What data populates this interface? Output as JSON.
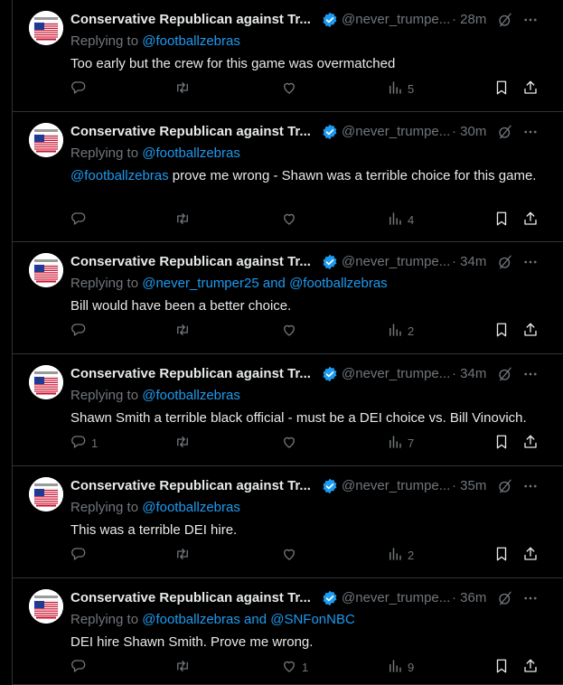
{
  "tweets": [
    {
      "name": "Conservative Republican against Tr...",
      "handle": "@never_trumpe...",
      "time": "· 28m",
      "reply_prefix": "Replying to ",
      "reply_to": "@footballzebras",
      "reply_extra_sep": "",
      "reply_extra": "",
      "mention": "",
      "text": "Too early but the crew for this game was overmatched",
      "replies": "",
      "likes": "",
      "views": "5"
    },
    {
      "name": "Conservative Republican against Tr...",
      "handle": "@never_trumpe...",
      "time": "· 30m",
      "reply_prefix": "Replying to ",
      "reply_to": "@footballzebras",
      "reply_extra_sep": "",
      "reply_extra": "",
      "mention": "@footballzebras",
      "text": " prove me wrong - Shawn was a terrible choice for this game.",
      "replies": "",
      "likes": "",
      "views": "4"
    },
    {
      "name": "Conservative Republican against Tr...",
      "handle": "@never_trumpe...",
      "time": "· 34m",
      "reply_prefix": "Replying to ",
      "reply_to": "@never_trumper25",
      "reply_extra_sep": " and ",
      "reply_extra": "@footballzebras",
      "mention": "",
      "text": "Bill would have been a better choice.",
      "replies": "",
      "likes": "",
      "views": "2"
    },
    {
      "name": "Conservative Republican against Tr...",
      "handle": "@never_trumpe...",
      "time": "· 34m",
      "reply_prefix": "Replying to ",
      "reply_to": "@footballzebras",
      "reply_extra_sep": "",
      "reply_extra": "",
      "mention": "",
      "text": "Shawn Smith a terrible black official - must be a DEI choice vs. Bill Vinovich.",
      "replies": "1",
      "likes": "",
      "views": "7"
    },
    {
      "name": "Conservative Republican against Tr...",
      "handle": "@never_trumpe...",
      "time": "· 35m",
      "reply_prefix": "Replying to ",
      "reply_to": "@footballzebras",
      "reply_extra_sep": "",
      "reply_extra": "",
      "mention": "",
      "text": "This was a terrible DEI hire.",
      "replies": "",
      "likes": "",
      "views": "2"
    },
    {
      "name": "Conservative Republican against Tr...",
      "handle": "@never_trumpe...",
      "time": "· 36m",
      "reply_prefix": "Replying to ",
      "reply_to": "@footballzebras",
      "reply_extra_sep": " and ",
      "reply_extra": "@SNFonNBC",
      "mention": "",
      "text": "DEI hire Shawn Smith. Prove me wrong.",
      "replies": "",
      "likes": "1",
      "views": "9"
    }
  ],
  "colors": {
    "background": "#000000",
    "text": "#e7e9ea",
    "muted": "#71767b",
    "link": "#1d9bf0",
    "verified": "#1d9bf0",
    "divider": "#2f3336"
  },
  "icons": {
    "verified": "verified-badge-icon",
    "grok": "grok-icon",
    "more": "more-icon",
    "reply": "reply-icon",
    "retweet": "retweet-icon",
    "like": "heart-icon",
    "views": "views-icon",
    "bookmark": "bookmark-icon",
    "share": "share-icon"
  }
}
